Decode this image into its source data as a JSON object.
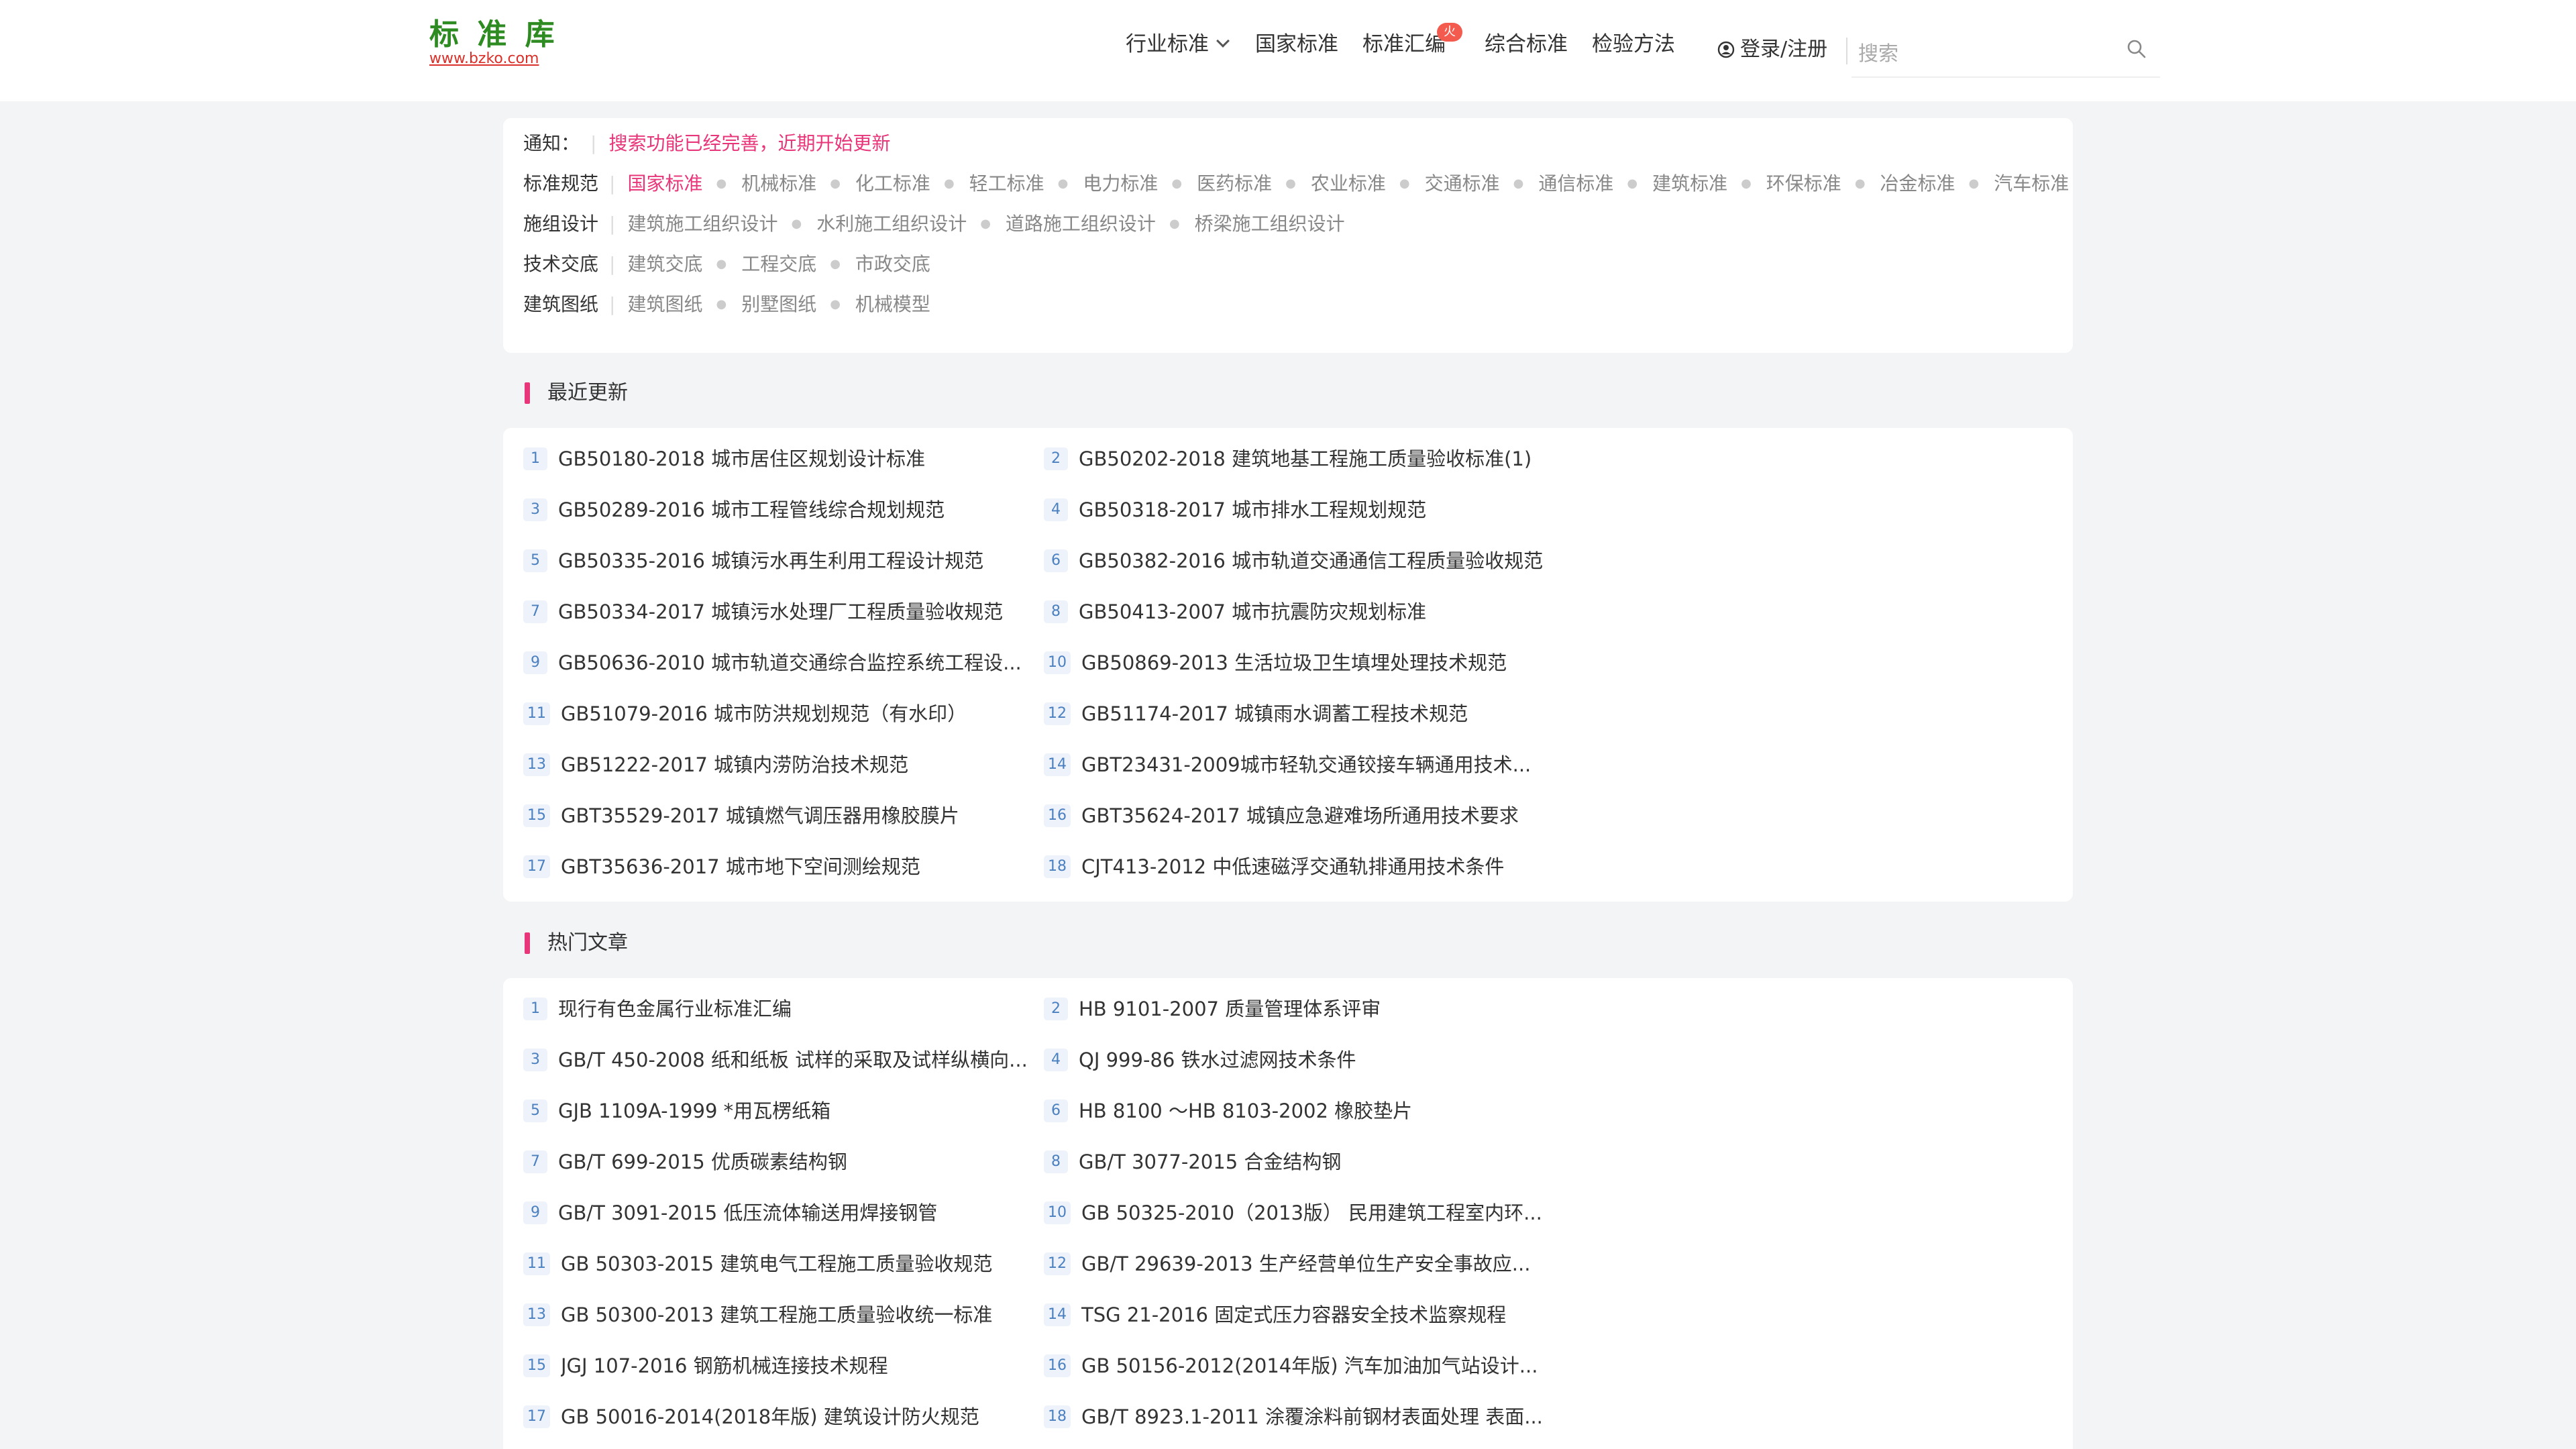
{
  "header": {
    "logo_text": "标 准 库",
    "logo_url": "www.bzko.com",
    "nav": [
      "行业标准",
      "国家标准",
      "标准汇编",
      "综合标准",
      "检验方法"
    ],
    "hot_badge": "火",
    "login": "登录/注册",
    "search_placeholder": "搜索"
  },
  "categories": {
    "notice_label": "通知：",
    "notice_text": "搜索功能已经完善，近期开始更新",
    "standards_label": "标准规范",
    "standards": [
      "国家标准",
      "机械标准",
      "化工标准",
      "轻工标准",
      "电力标准",
      "医药标准",
      "农业标准",
      "交通标准",
      "通信标准",
      "建筑标准",
      "环保标准",
      "冶金标准",
      "汽车标准"
    ],
    "design_label": "施组设计",
    "design": [
      "建筑施工组织设计",
      "水利施工组织设计",
      "道路施工组织设计",
      "桥梁施工组织设计"
    ],
    "tech_label": "技术交底",
    "tech": [
      "建筑交底",
      "工程交底",
      "市政交底"
    ],
    "drawing_label": "建筑图纸",
    "drawing": [
      "建筑图纸",
      "别墅图纸",
      "机械模型"
    ]
  },
  "recent": {
    "title": "最近更新",
    "items": [
      {
        "num": "1",
        "text": "GB50180-2018 城市居住区规划设计标准"
      },
      {
        "num": "2",
        "text": "GB50202-2018 建筑地基工程施工质量验收标准(1)"
      },
      {
        "num": "3",
        "text": "GB50289-2016 城市工程管线综合规划规范"
      },
      {
        "num": "4",
        "text": "GB50318-2017 城市排水工程规划规范"
      },
      {
        "num": "5",
        "text": "GB50335-2016 城镇污水再生利用工程设计规范"
      },
      {
        "num": "6",
        "text": "GB50382-2016 城市轨道交通通信工程质量验收规范"
      },
      {
        "num": "7",
        "text": "GB50334-2017 城镇污水处理厂工程质量验收规范"
      },
      {
        "num": "8",
        "text": "GB50413-2007 城市抗震防灾规划标准"
      },
      {
        "num": "9",
        "text": "GB50636-2010 城市轨道交通综合监控系统工程设..."
      },
      {
        "num": "10",
        "text": "GB50869-2013 生活垃圾卫生填埋处理技术规范"
      },
      {
        "num": "11",
        "text": "GB51079-2016 城市防洪规划规范（有水印）"
      },
      {
        "num": "12",
        "text": "GB51174-2017 城镇雨水调蓄工程技术规范"
      },
      {
        "num": "13",
        "text": "GB51222-2017 城镇内涝防治技术规范"
      },
      {
        "num": "14",
        "text": "GBT23431-2009城市轻轨交通铰接车辆通用技术..."
      },
      {
        "num": "15",
        "text": "GBT35529-2017 城镇燃气调压器用橡胶膜片"
      },
      {
        "num": "16",
        "text": "GBT35624-2017 城镇应急避难场所通用技术要求"
      },
      {
        "num": "17",
        "text": "GBT35636-2017 城市地下空间测绘规范"
      },
      {
        "num": "18",
        "text": "CJT413-2012 中低速磁浮交通轨排通用技术条件"
      }
    ]
  },
  "hot": {
    "title": "热门文章",
    "items": [
      {
        "num": "1",
        "text": "现行有色金属行业标准汇编"
      },
      {
        "num": "2",
        "text": "HB 9101-2007 质量管理体系评审"
      },
      {
        "num": "3",
        "text": "GB/T 450-2008 纸和纸板 试样的采取及试样纵横向..."
      },
      {
        "num": "4",
        "text": "QJ 999-86 铁水过滤网技术条件"
      },
      {
        "num": "5",
        "text": "GJB 1109A-1999 *用瓦楞纸箱"
      },
      {
        "num": "6",
        "text": "HB 8100 ～HB 8103-2002 橡胶垫片"
      },
      {
        "num": "7",
        "text": "GB/T 699-2015 优质碳素结构钢"
      },
      {
        "num": "8",
        "text": "GB/T 3077-2015 合金结构钢"
      },
      {
        "num": "9",
        "text": "GB/T 3091-2015 低压流体输送用焊接钢管"
      },
      {
        "num": "10",
        "text": "GB 50325-2010（2013版） 民用建筑工程室内环..."
      },
      {
        "num": "11",
        "text": "GB 50303-2015 建筑电气工程施工质量验收规范"
      },
      {
        "num": "12",
        "text": "GB/T 29639-2013 生产经营单位生产安全事故应..."
      },
      {
        "num": "13",
        "text": "GB 50300-2013 建筑工程施工质量验收统一标准"
      },
      {
        "num": "14",
        "text": "TSG 21-2016 固定式压力容器安全技术监察规程"
      },
      {
        "num": "15",
        "text": "JGJ 107-2016 钢筋机械连接技术规程"
      },
      {
        "num": "16",
        "text": "GB 50156-2012(2014年版) 汽车加油加气站设计..."
      },
      {
        "num": "17",
        "text": "GB 50016-2014(2018年版) 建筑设计防火规范"
      },
      {
        "num": "18",
        "text": "GB/T 8923.1-2011 涂覆涂料前钢材表面处理 表面..."
      }
    ]
  }
}
